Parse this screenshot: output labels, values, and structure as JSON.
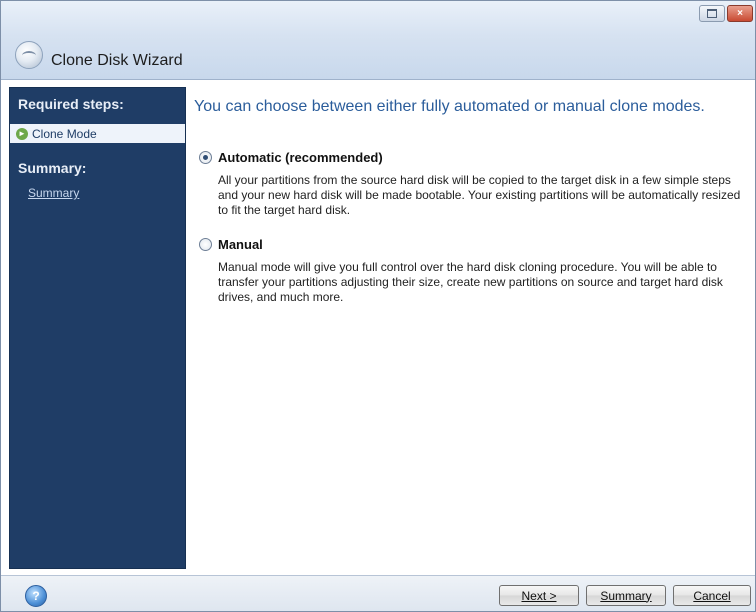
{
  "window": {
    "title": "Clone Disk Wizard",
    "controls": {
      "restore": "restore-icon",
      "close": "×"
    }
  },
  "sidebar": {
    "required_heading": "Required steps:",
    "active_step": "Clone Mode",
    "summary_heading": "Summary:",
    "summary_link": "Summary"
  },
  "main": {
    "heading": "You can choose between either fully automated or manual clone modes.",
    "options": [
      {
        "label": "Automatic (recommended)",
        "checked": true,
        "description": "All your partitions from the source hard disk will be copied to the target disk in a few simple steps and your new hard disk will be made bootable. Your existing partitions will be automatically resized to fit the target hard disk."
      },
      {
        "label": "Manual",
        "checked": false,
        "description": "Manual mode will give you full control over the hard disk cloning procedure. You will be able to transfer your partitions adjusting their size, create new partitions on source and target hard disk drives, and much more."
      }
    ]
  },
  "footer": {
    "help_icon": "?",
    "next_label": "Next >",
    "summary_label": "Summary",
    "cancel_label": "Cancel"
  },
  "colors": {
    "sidebar_bg": "#1f3d66",
    "heading_blue": "#2b5d9b"
  }
}
